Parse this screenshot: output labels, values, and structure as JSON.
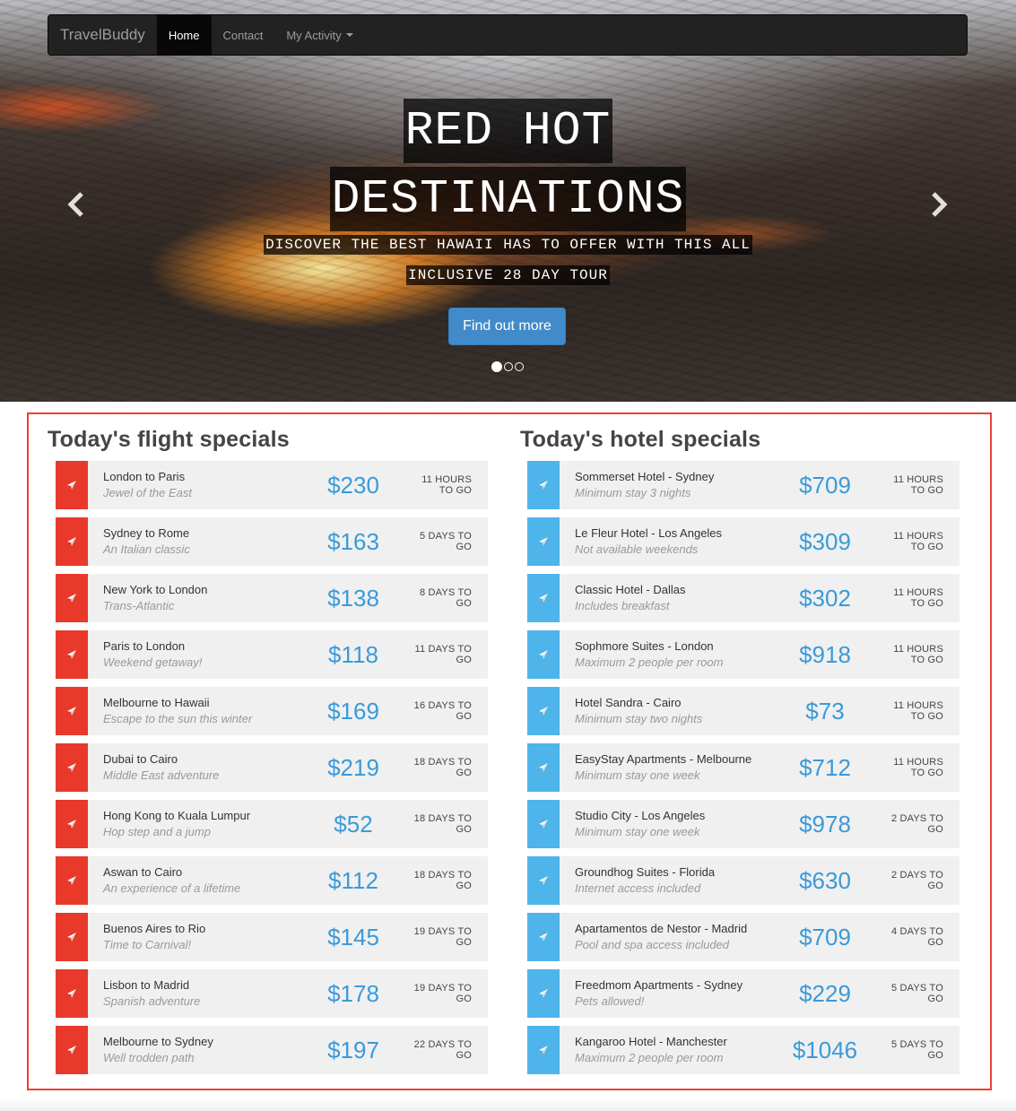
{
  "navbar": {
    "brand": "TravelBuddy",
    "items": [
      {
        "label": "Home",
        "active": true
      },
      {
        "label": "Contact",
        "active": false
      },
      {
        "label": "My Activity",
        "active": false,
        "dropdown": true
      }
    ]
  },
  "hero": {
    "title_line1": "RED HOT",
    "title_line2": "DESTINATIONS",
    "subtitle_line1": "DISCOVER THE BEST HAWAII HAS TO OFFER WITH THIS ALL",
    "subtitle_line2": "INCLUSIVE 28 DAY TOUR",
    "cta_label": "Find out more",
    "slide_count": 3,
    "active_slide": 1,
    "prev_icon": "chevron-left-icon",
    "next_icon": "chevron-right-icon"
  },
  "colors": {
    "flight_icon_bg": "#e8392b",
    "hotel_icon_bg": "#4eb4ea",
    "price": "#3a9ad9",
    "frame": "#e8412f"
  },
  "flights": {
    "heading": "Today's flight specials",
    "icon": "paper-plane-icon",
    "items": [
      {
        "name": "London to Paris",
        "desc": "Jewel of the East",
        "price": "$230",
        "togo": "11 HOURS TO GO"
      },
      {
        "name": "Sydney to Rome",
        "desc": "An Italian classic",
        "price": "$163",
        "togo": "5 DAYS TO GO"
      },
      {
        "name": "New York to London",
        "desc": "Trans-Atlantic",
        "price": "$138",
        "togo": "8 DAYS TO GO"
      },
      {
        "name": "Paris to London",
        "desc": "Weekend getaway!",
        "price": "$118",
        "togo": "11 DAYS TO GO"
      },
      {
        "name": "Melbourne to Hawaii",
        "desc": "Escape to the sun this winter",
        "price": "$169",
        "togo": "16 DAYS TO GO"
      },
      {
        "name": "Dubai to Cairo",
        "desc": "Middle East adventure",
        "price": "$219",
        "togo": "18 DAYS TO GO"
      },
      {
        "name": "Hong Kong to Kuala Lumpur",
        "desc": "Hop step and a jump",
        "price": "$52",
        "togo": "18 DAYS TO GO"
      },
      {
        "name": "Aswan to Cairo",
        "desc": "An experience of a lifetime",
        "price": "$112",
        "togo": "18 DAYS TO GO"
      },
      {
        "name": "Buenos Aires to Rio",
        "desc": "Time to Carnival!",
        "price": "$145",
        "togo": "19 DAYS TO GO"
      },
      {
        "name": "Lisbon to Madrid",
        "desc": "Spanish adventure",
        "price": "$178",
        "togo": "19 DAYS TO GO"
      },
      {
        "name": "Melbourne to Sydney",
        "desc": "Well trodden path",
        "price": "$197",
        "togo": "22 DAYS TO GO"
      }
    ]
  },
  "hotels": {
    "heading": "Today's hotel specials",
    "icon": "paper-plane-icon",
    "items": [
      {
        "name": "Sommerset Hotel - Sydney",
        "desc": "Minimum stay 3 nights",
        "price": "$709",
        "togo": "11 HOURS TO GO"
      },
      {
        "name": "Le Fleur Hotel - Los Angeles",
        "desc": "Not available weekends",
        "price": "$309",
        "togo": "11 HOURS TO GO"
      },
      {
        "name": "Classic Hotel - Dallas",
        "desc": "Includes breakfast",
        "price": "$302",
        "togo": "11 HOURS TO GO"
      },
      {
        "name": "Sophmore Suites - London",
        "desc": "Maximum 2 people per room",
        "price": "$918",
        "togo": "11 HOURS TO GO"
      },
      {
        "name": "Hotel Sandra - Cairo",
        "desc": "Minimum stay two nights",
        "price": "$73",
        "togo": "11 HOURS TO GO"
      },
      {
        "name": "EasyStay Apartments - Melbourne",
        "desc": "Minimum stay one week",
        "price": "$712",
        "togo": "11 HOURS TO GO"
      },
      {
        "name": "Studio City - Los Angeles",
        "desc": "Minimum stay one week",
        "price": "$978",
        "togo": "2 DAYS TO GO"
      },
      {
        "name": "Groundhog Suites - Florida",
        "desc": "Internet access included",
        "price": "$630",
        "togo": "2 DAYS TO GO"
      },
      {
        "name": "Apartamentos de Nestor - Madrid",
        "desc": "Pool and spa access included",
        "price": "$709",
        "togo": "4 DAYS TO GO"
      },
      {
        "name": "Freedmom Apartments - Sydney",
        "desc": "Pets allowed!",
        "price": "$229",
        "togo": "5 DAYS TO GO"
      },
      {
        "name": "Kangaroo Hotel - Manchester",
        "desc": "Maximum 2 people per room",
        "price": "$1046",
        "togo": "5 DAYS TO GO"
      }
    ]
  }
}
